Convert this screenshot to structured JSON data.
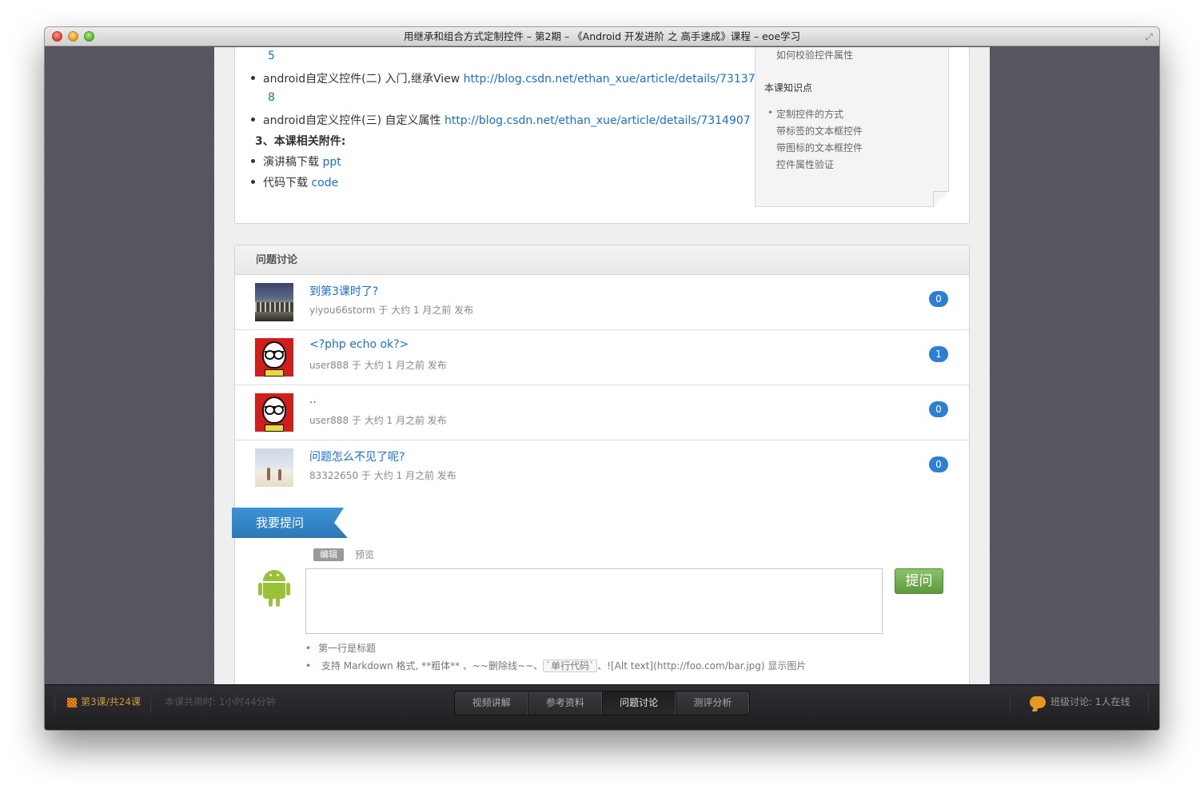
{
  "window": {
    "title": "用继承和组合方式定制控件 – 第2期 – 《Android 开发进阶 之 高手速成》课程 – eoe学习"
  },
  "content": {
    "line_5": "5",
    "item2_text": "android自定义控件(二) 入门,继承View ",
    "item2_link": "http://blog.csdn.net/ethan_xue/article/details/731378",
    "line_8": "8",
    "item3_text": "android自定义控件(三) 自定义属性 ",
    "item3_link": "http://blog.csdn.net/ethan_xue/article/details/7314907",
    "section3_title": "3、本课相关附件:",
    "attach1_text": "演讲稿下载 ",
    "attach1_link": "ppt",
    "attach2_text": "代码下载 ",
    "attach2_link": "code"
  },
  "toc": {
    "prev_item": "如何校验控件属性",
    "title": "本课知识点",
    "items": [
      "定制控件的方式",
      "带标签的文本框控件",
      "带图标的文本框控件",
      "控件属性验证"
    ]
  },
  "discussion": {
    "header": "问题讨论",
    "questions": [
      {
        "title": "到第3课时了?",
        "meta": "yiyou66storm 于 大约 1 月之前 发布",
        "count": "0"
      },
      {
        "title": "<?php echo ok?>",
        "meta": "user888 于 大约 1 月之前 发布",
        "count": "1"
      },
      {
        "title": "..",
        "meta": "user888 于 大约 1 月之前 发布",
        "count": "0"
      },
      {
        "title": "问题怎么不见了呢?",
        "meta": "83322650 于 大约 1 月之前 发布",
        "count": "0"
      }
    ]
  },
  "ask": {
    "ribbon": "我要提问",
    "tab_edit": "编辑",
    "tab_preview": "预览",
    "submit": "提问",
    "hint1": "第一行是标题",
    "hint2_a": "支持 Markdown 格式, **粗体** 、~~删除线~~、",
    "hint2_code": "`单行代码`",
    "hint2_b": "、![Alt text](http://foo.com/bar.jpg) 显示图片"
  },
  "bottombar": {
    "lesson": "第3课/共24课",
    "time": "本课共用时: 1小时44分钟",
    "tabs": [
      "视频讲解",
      "参考资料",
      "问题讨论",
      "测评分析"
    ],
    "active_tab": "问题讨论",
    "chat": "班级讨论: 1人在线"
  },
  "colors": {
    "link": "#1a6fcc",
    "badge": "#2d7fd3",
    "ribbon": "#2b78b8",
    "submit": "#6aa64a",
    "lesson_accent": "#e7a02a"
  }
}
